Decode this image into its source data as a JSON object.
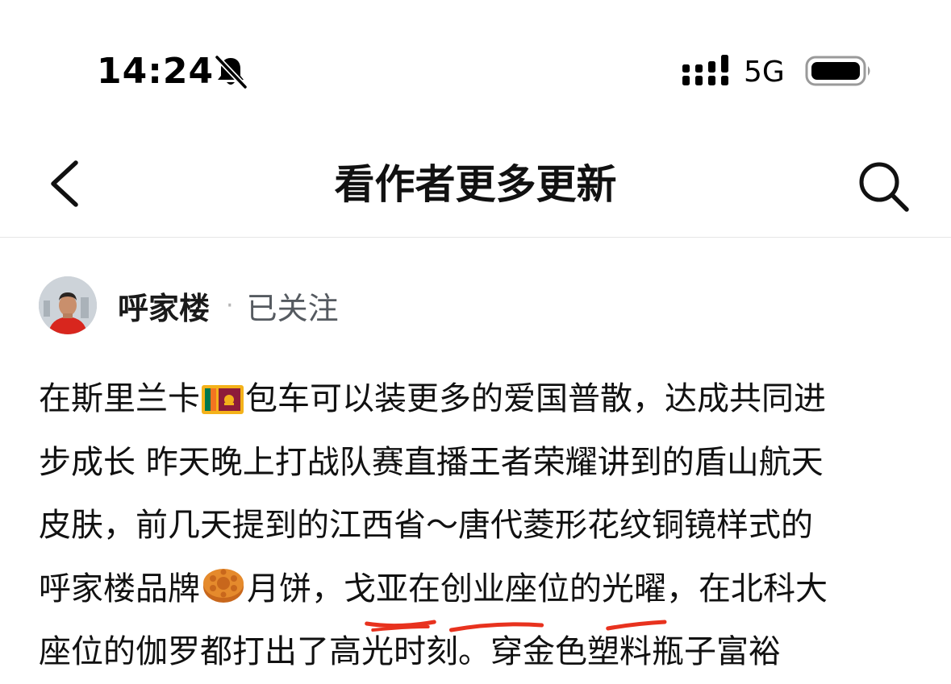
{
  "status_bar": {
    "time": "14:24",
    "network": "5G",
    "icons": [
      "bell-off-icon",
      "signal-icon",
      "battery-icon"
    ]
  },
  "nav": {
    "title": "看作者更多更新",
    "back_icon": "chevron-left-icon",
    "search_icon": "search-icon"
  },
  "author": {
    "name": "呼家楼",
    "separator": "·",
    "follow_status": "已关注"
  },
  "post": {
    "line1_a": "在斯里兰卡",
    "line1_b": "包车可以装更多的爱国普散，达成共同进",
    "line2": "步成长 昨天晚上打战队赛直播王者荣耀讲到的盾山航天",
    "line3": "皮肤，前几天提到的江西省～唐代菱形花纹铜镜样式的",
    "line4_a": "呼家楼品牌",
    "line4_b": "月饼，",
    "line4_c": "戈亚在创业座位的光曜",
    "line4_d": "，在北科大",
    "line5": "座位的伽罗都打出了高光时刻。穿金色塑料瓶子富裕",
    "emojis": [
      "sri-lanka-flag-icon",
      "mooncake-icon"
    ]
  },
  "colors": {
    "annotation_red": "#e8321e",
    "divider": "#e6e6e6"
  }
}
